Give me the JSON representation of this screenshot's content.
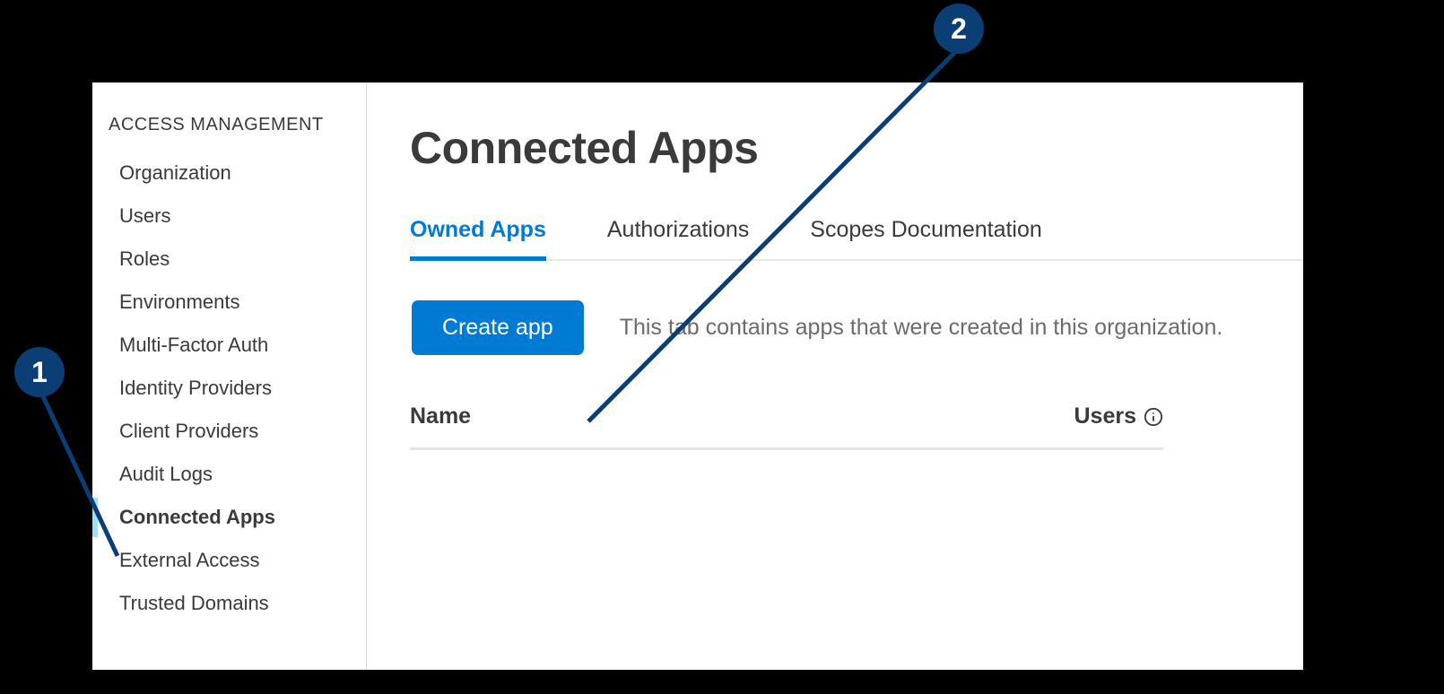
{
  "sidebar": {
    "header": "ACCESS MANAGEMENT",
    "items": [
      {
        "label": "Organization",
        "active": false
      },
      {
        "label": "Users",
        "active": false
      },
      {
        "label": "Roles",
        "active": false
      },
      {
        "label": "Environments",
        "active": false
      },
      {
        "label": "Multi-Factor Auth",
        "active": false
      },
      {
        "label": "Identity Providers",
        "active": false
      },
      {
        "label": "Client Providers",
        "active": false
      },
      {
        "label": "Audit Logs",
        "active": false
      },
      {
        "label": "Connected Apps",
        "active": true
      },
      {
        "label": "External Access",
        "active": false
      },
      {
        "label": "Trusted Domains",
        "active": false
      }
    ]
  },
  "main": {
    "title": "Connected Apps",
    "tabs": [
      {
        "label": "Owned Apps",
        "active": true
      },
      {
        "label": "Authorizations",
        "active": false
      },
      {
        "label": "Scopes Documentation",
        "active": false
      }
    ],
    "create_button": "Create app",
    "hint": "This tab contains apps that were created in this organization.",
    "columns": {
      "name": "Name",
      "users": "Users"
    }
  },
  "callouts": {
    "one": "1",
    "two": "2"
  },
  "colors": {
    "accent": "#007bd4",
    "callout": "#0b3e75"
  }
}
